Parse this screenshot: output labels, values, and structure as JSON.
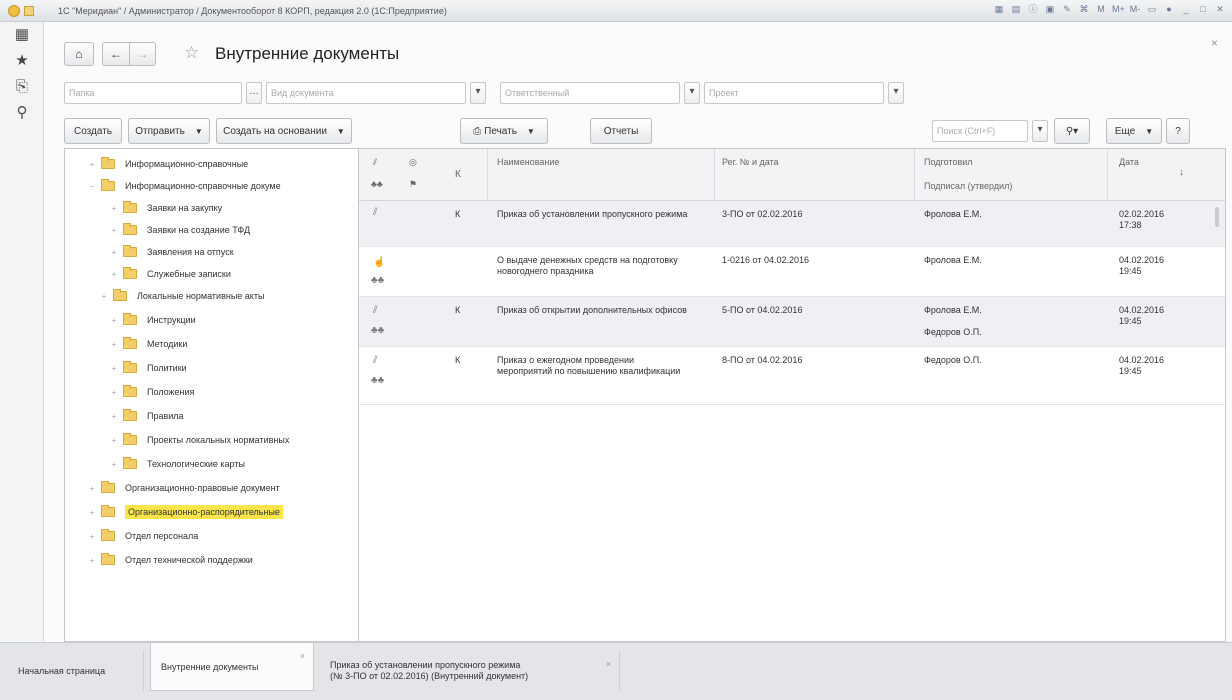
{
  "window": {
    "title": "1С \"Меридиан\" / Администратор / Документооборот 8 КОРП, редакция 2.0 (1С:Предприятие)"
  },
  "sidebar": {
    "icons": [
      "apps-icon",
      "star-icon",
      "history-icon",
      "search-icon"
    ]
  },
  "header": {
    "title": "Внутренние документы"
  },
  "filters": {
    "placeholders": [
      "Папка",
      "Вид документа",
      "Ответственный",
      "Проект"
    ]
  },
  "toolbar": {
    "create": "Создать",
    "send": "Отправить",
    "create_based": "Создать на основании",
    "print": "Печать",
    "reports": "Отчеты",
    "search_placeholder": "Поиск (Ctrl+F)",
    "more": "Еще",
    "help": "?"
  },
  "tree": {
    "items": [
      {
        "label": "Информационно-справочные",
        "level": 1,
        "selected": false
      },
      {
        "label": "Информационно-справочные докуме",
        "level": 1,
        "selected": false
      },
      {
        "label": "Заявки на закупку",
        "level": 2,
        "selected": false
      },
      {
        "label": "Заявки на создание ТФД",
        "level": 2,
        "selected": false
      },
      {
        "label": "Заявления на отпуск",
        "level": 2,
        "selected": false
      },
      {
        "label": "Служебные записки",
        "level": 2,
        "selected": false
      },
      {
        "label": "Локальные нормативные акты",
        "level": 1,
        "selected": false
      },
      {
        "label": "Инструкции",
        "level": 2,
        "selected": false
      },
      {
        "label": "Методики",
        "level": 2,
        "selected": false
      },
      {
        "label": "Политики",
        "level": 2,
        "selected": false
      },
      {
        "label": "Положения",
        "level": 2,
        "selected": false
      },
      {
        "label": "Правила",
        "level": 2,
        "selected": false
      },
      {
        "label": "Проекты локальных нормативных",
        "level": 2,
        "selected": false
      },
      {
        "label": "Технологические карты",
        "level": 2,
        "selected": false
      },
      {
        "label": "Организационно-правовые документ",
        "level": 1,
        "selected": false
      },
      {
        "label": "Организационно-распорядительные",
        "level": 1,
        "selected": true
      },
      {
        "label": "Отдел персонала",
        "level": 1,
        "selected": false
      },
      {
        "label": "Отдел технической поддержки",
        "level": 1,
        "selected": false
      }
    ]
  },
  "grid": {
    "columns": {
      "k": "К",
      "name": "Наименование",
      "reg": "Рег. № и дата",
      "prepared": "Подготовил",
      "signed": "Подписал (утвердил)",
      "date": "Дата"
    },
    "rows": [
      {
        "k": "К",
        "name": "Приказ об установлении пропускного режима",
        "reg": "3-ПО от 02.02.2016",
        "prepared": "Фролова Е.М.",
        "signed": "",
        "date": "02.02.2016 17:38",
        "selected": true
      },
      {
        "k": "",
        "name": "О выдаче денежных средств на подготовку новогоднего праздника",
        "reg": "1-0216 от 04.02.2016",
        "prepared": "Фролова Е.М.",
        "signed": "",
        "date": "04.02.2016 19:45",
        "selected": false
      },
      {
        "k": "К",
        "name": "Приказ об открытии дополнительных офисов",
        "reg": "5-ПО от 04.02.2016",
        "prepared": "Фролова Е.М.",
        "signed": "Федоров О.П.",
        "date": "04.02.2016 19:45",
        "selected": false
      },
      {
        "k": "К",
        "name": "Приказ о ежегодном проведении мероприятий по повышению квалификации",
        "reg": "8-ПО от 04.02.2016",
        "prepared": "Федоров О.П.",
        "signed": "",
        "date": "04.02.2016 19:45",
        "selected": false
      }
    ]
  },
  "tabs": {
    "home": "Начальная страница",
    "internal": "Внутренние документы",
    "order_line1": "Приказ об установлении пропускного режима",
    "order_line2": "(№ 3-ПО от 02.02.2016) (Внутренний документ)"
  }
}
